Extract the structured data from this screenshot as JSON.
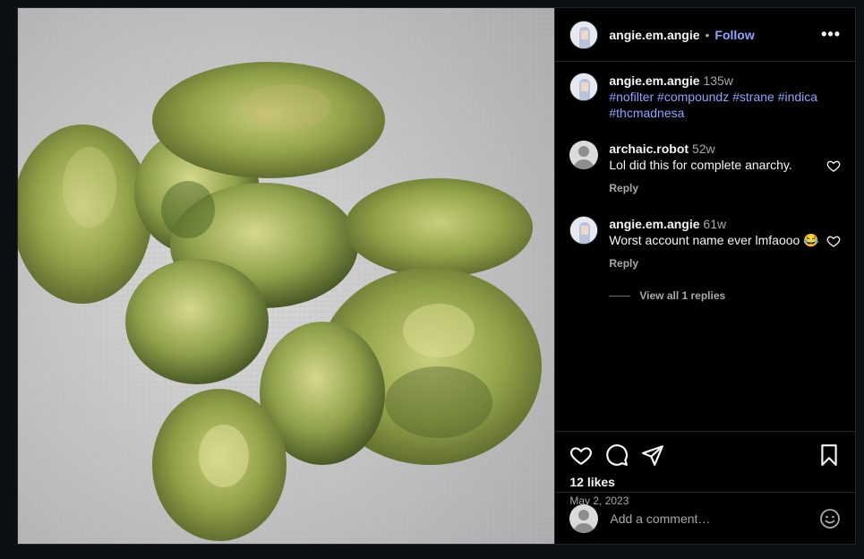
{
  "post": {
    "author": "angie.em.angie",
    "separator": "•",
    "follow_label": "Follow",
    "more_label": "•••",
    "likes": "12 likes",
    "date": "May 2, 2023",
    "add_comment_placeholder": "Add a comment…"
  },
  "caption": {
    "username": "angie.em.angie",
    "time": "135w",
    "hashtags": "#nofilter #compoundz #strane #indica #thcmadnesa"
  },
  "comments": [
    {
      "username": "archaic.robot",
      "time": "52w",
      "text": "Lol did this for complete anarchy.",
      "reply_label": "Reply"
    },
    {
      "username": "angie.em.angie",
      "time": "61w",
      "text": "Worst account name ever lmfaooo 😂",
      "reply_label": "Reply"
    }
  ],
  "view_replies_label": "View all 1 replies",
  "icons": {
    "like": "heart-icon",
    "comment": "comment-bubble-icon",
    "share": "paper-plane-icon",
    "save": "bookmark-icon",
    "emoji": "smiley-icon",
    "more": "more-dots-icon"
  },
  "colors": {
    "background": "#0c1014",
    "panel": "#000000",
    "link": "#8ea3ff",
    "muted": "#a8a8a8",
    "divider": "#262626"
  }
}
